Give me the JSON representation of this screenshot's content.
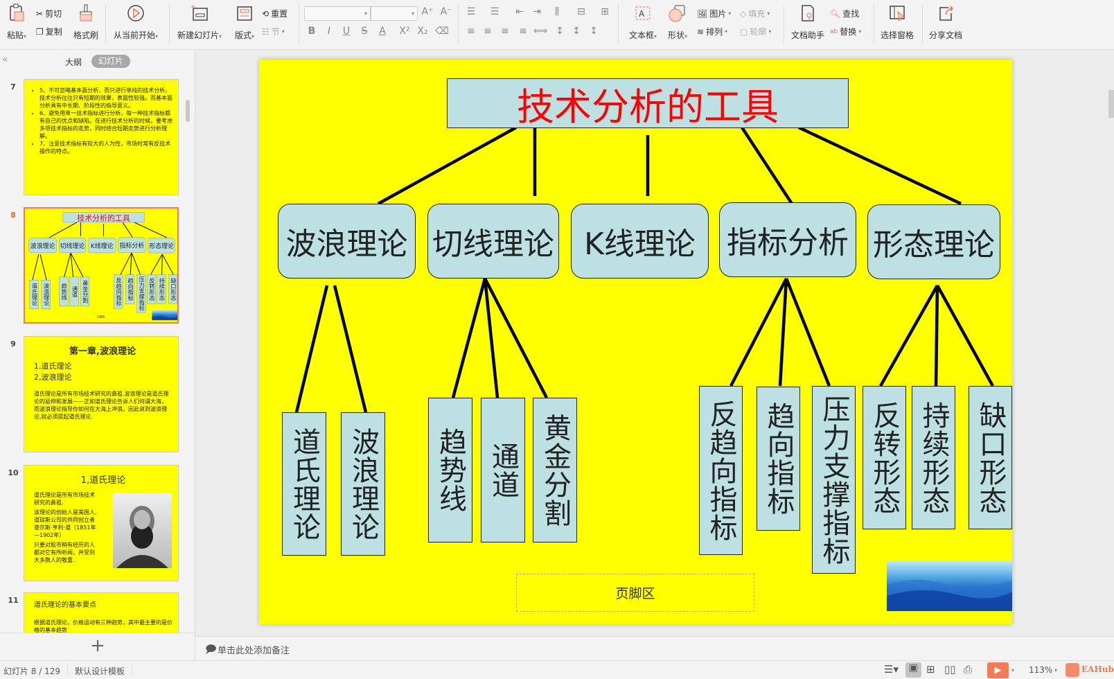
{
  "toolbar": {
    "paste": "粘贴",
    "cut": "剪切",
    "copy": "复制",
    "format_painter": "格式刷",
    "from_current": "从当前开始",
    "new_slide": "新建幻灯片",
    "layout": "版式",
    "reset": "重置",
    "section": "节",
    "textbox": "文本框",
    "shape": "形状",
    "picture": "图片",
    "arrange": "排列",
    "fill": "填充",
    "outline": "轮廓",
    "doc_assistant": "文档助手",
    "find": "查找",
    "replace": "替换",
    "selection_pane": "选择窗格",
    "share": "分享文档",
    "font_name": "",
    "font_size": ""
  },
  "left_panel": {
    "collapse": "«",
    "tab_outline": "大纲",
    "tab_slides": "幻灯片",
    "add": "+",
    "thumbs": [
      {
        "num": "7",
        "lines": [
          "5、不可忽略基本面分析，而只进行单纯的技术分析。技术分析往往只有短期的效果，表面性较强。而基本面分析具有中长期、阶段性的指导意义。",
          "6、避免用单一技术指标进行分析，每一种技术指标都有自己的优点和缺陷。在进行技术分析的时候，要考虑多项技术指标的走势，同时结合短期走势进行分析理解。",
          "7、注意技术指标有较大的人为性，市场时常有反技术操作的特点。"
        ]
      },
      {
        "num": "8"
      },
      {
        "num": "9",
        "title": "第一章,波浪理论",
        "bullets": [
          "1,道氏理论",
          "2,波浪理论"
        ],
        "body": "道氏理论是所有市场技术研究的鼻祖.波浪理论是道氏理论的延伸和发展——正如道氏理论告诉人们何谓大海，而波浪理论指导你如何在大海上冲浪。因此说到波浪理论,就必须提起道氏理论."
      },
      {
        "num": "10",
        "title": "1,道氏理论",
        "bullets": [
          "道氏理论是所有市场技术研究的鼻祖.",
          "该理论的创始人是美国人,道琼斯公司的共同创立者查尔斯·亨利·道（1851年—1902年）",
          "只要对股市稍有经历的人都对它有所听闻，并受到大多数人的敬重."
        ]
      },
      {
        "num": "11",
        "title": "道氏理论的基本要点",
        "bullets": [
          "根据道氏理论，价格运动有三种趋势，其中最主要的是价格的基本趋势"
        ]
      }
    ]
  },
  "slide": {
    "title": "技术分析的工具",
    "title_color": "#ff0000",
    "level1": [
      "波浪理论",
      "切线理论",
      "K线理论",
      "指标分析",
      "形态理论"
    ],
    "level2": [
      "道氏理论",
      "波浪理论",
      "趋势线",
      "通道",
      "黄金分割",
      "反趋向指标",
      "趋向指标",
      "压力支撑指标",
      "反转形态",
      "持续形态",
      "缺口形态"
    ],
    "footer": "页脚区"
  },
  "notes": {
    "placeholder": "单击此处添加备注"
  },
  "status": {
    "slide_info": "幻灯片 8 / 129",
    "template": "默认设计模板",
    "zoom": "113%",
    "logo": "EAHub"
  },
  "colors": {
    "slide_bg": "#ffff00",
    "box_fill": "#bde0e3",
    "accent": "#f07b56"
  }
}
